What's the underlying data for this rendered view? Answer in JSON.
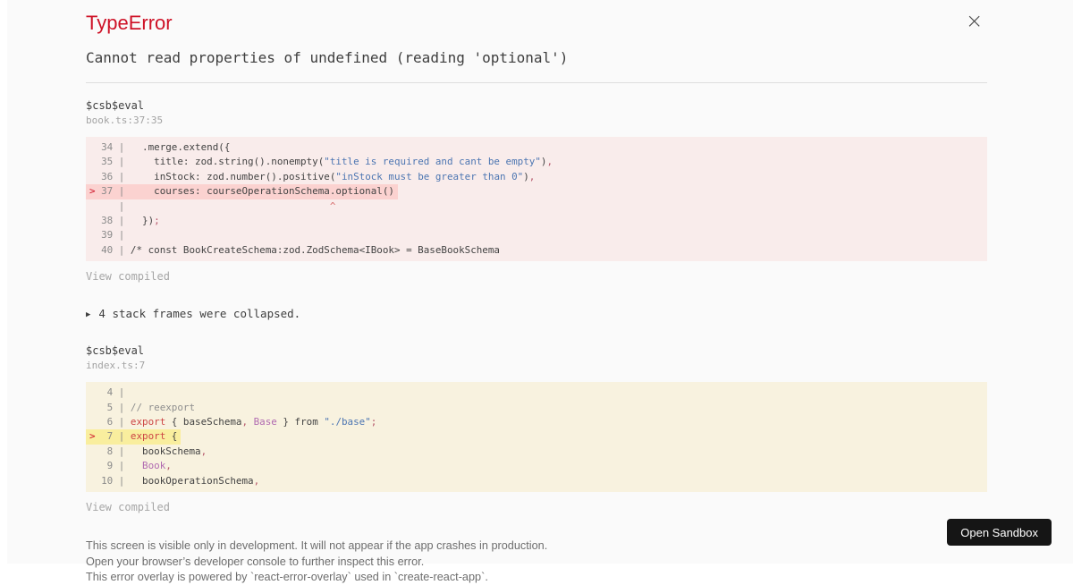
{
  "overlay": {
    "title": "TypeError",
    "message": "Cannot read properties of undefined (reading 'optional')",
    "close_icon": "×"
  },
  "colors": {
    "accent-red": "#ce1126",
    "bg": "#fafafa",
    "code-bg-error": "#f9eceb",
    "code-hl-error": "#fbd2d0",
    "code-bg-warning": "#f8f2df",
    "code-hl-warning": "#f9ee9e",
    "string": "#4d76b2",
    "keyword": "#cd4646",
    "capitalized": "#b16bb1",
    "punctuation": "#b5566a",
    "comment": "#8f8f8f",
    "button-bg": "#151515"
  },
  "collapsed": {
    "icon": "▶",
    "label": "4 stack frames were collapsed."
  },
  "frames": [
    {
      "function": "$csb$eval",
      "location": "book.ts:37:35",
      "variant": "error",
      "view_compiled": "View compiled",
      "lines": [
        {
          "h": false,
          "toks": [
            [
              "  34 | ",
              "gutter"
            ],
            [
              "  .merge.extend({",
              "plain"
            ]
          ]
        },
        {
          "h": false,
          "toks": [
            [
              "  35 | ",
              "gutter"
            ],
            [
              "    title: zod.string().nonempty(",
              "plain"
            ],
            [
              "\"title is required and cant be empty\"",
              "string"
            ],
            [
              ")",
              "plain"
            ],
            [
              ",",
              "punct"
            ]
          ]
        },
        {
          "h": false,
          "toks": [
            [
              "  36 | ",
              "gutter"
            ],
            [
              "    inStock: zod.number().positive(",
              "plain"
            ],
            [
              "\"inStock must be greater than 0\"",
              "string"
            ],
            [
              ")",
              "plain"
            ],
            [
              ",",
              "punct"
            ]
          ]
        },
        {
          "h": true,
          "toks": [
            [
              ">",
              "marker"
            ],
            [
              " 37 | ",
              "gutter"
            ],
            [
              "    courses: courseOperationSchema.optional()",
              "plain"
            ]
          ]
        },
        {
          "h": false,
          "toks": [
            [
              "     | ",
              "gutter"
            ],
            [
              "                                  ^",
              "caret"
            ]
          ]
        },
        {
          "h": false,
          "toks": [
            [
              "  38 | ",
              "gutter"
            ],
            [
              "  })",
              "plain"
            ],
            [
              ";",
              "punct"
            ]
          ]
        },
        {
          "h": false,
          "toks": [
            [
              "  39 | ",
              "gutter"
            ]
          ]
        },
        {
          "h": false,
          "toks": [
            [
              "  40 | ",
              "gutter"
            ],
            [
              "/* const BookCreateSchema:zod.ZodSchema<IBook> = BaseBookSchema",
              "plain"
            ]
          ]
        }
      ]
    },
    {
      "function": "$csb$eval",
      "location": "index.ts:7",
      "variant": "warning",
      "view_compiled": "View compiled",
      "lines": [
        {
          "h": false,
          "toks": [
            [
              "   4 | ",
              "gutter"
            ]
          ]
        },
        {
          "h": false,
          "toks": [
            [
              "   5 | ",
              "gutter"
            ],
            [
              "// reexport",
              "comment"
            ]
          ]
        },
        {
          "h": false,
          "toks": [
            [
              "   6 | ",
              "gutter"
            ],
            [
              "export",
              "keyword"
            ],
            [
              " { baseSchema",
              "plain"
            ],
            [
              ",",
              "punct"
            ],
            [
              " ",
              "plain"
            ],
            [
              "Base",
              "cap"
            ],
            [
              " } from ",
              "plain"
            ],
            [
              "\"./base\"",
              "string"
            ],
            [
              ";",
              "punct"
            ]
          ]
        },
        {
          "h": true,
          "toks": [
            [
              ">",
              "marker"
            ],
            [
              "  7 | ",
              "gutter"
            ],
            [
              "export",
              "keyword"
            ],
            [
              " {",
              "plain"
            ]
          ]
        },
        {
          "h": false,
          "toks": [
            [
              "   8 | ",
              "gutter"
            ],
            [
              "  bookSchema",
              "plain"
            ],
            [
              ",",
              "punct"
            ]
          ]
        },
        {
          "h": false,
          "toks": [
            [
              "   9 | ",
              "gutter"
            ],
            [
              "  ",
              "plain"
            ],
            [
              "Book",
              "cap"
            ],
            [
              ",",
              "punct"
            ]
          ]
        },
        {
          "h": false,
          "toks": [
            [
              "  10 | ",
              "gutter"
            ],
            [
              "  bookOperationSchema",
              "plain"
            ],
            [
              ",",
              "punct"
            ]
          ]
        }
      ]
    }
  ],
  "footer": {
    "line1": "This screen is visible only in development. It will not appear if the app crashes in production.",
    "line2": "Open your browser’s developer console to further inspect this error.",
    "line3": "This error overlay is powered by `react-error-overlay` used in `create-react-app`.",
    "open_sandbox": "Open Sandbox"
  }
}
